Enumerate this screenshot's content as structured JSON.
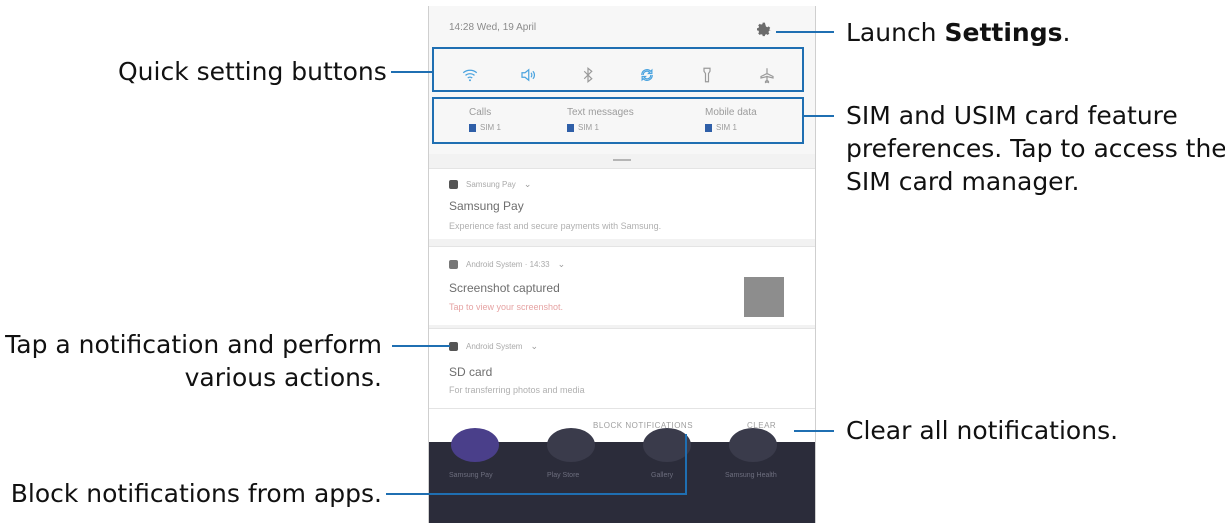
{
  "callouts": {
    "quick_settings": "Quick setting buttons",
    "tap_notification_line1": "Tap a notification and perform",
    "tap_notification_line2": "various actions.",
    "block": "Block notifications from apps.",
    "launch_prefix": "Launch ",
    "launch_bold": "Settings",
    "launch_suffix": ".",
    "sim_line1": "SIM and USIM card feature",
    "sim_line2": "preferences. Tap to access the",
    "sim_line3": "SIM card manager.",
    "clear": "Clear all notifications."
  },
  "phone": {
    "status_time": "14:28  Wed, 19 April",
    "quick_settings": [
      "wifi-icon",
      "sound-icon",
      "bluetooth-icon",
      "rotation-icon",
      "flashlight-icon",
      "airplane-icon"
    ],
    "sim": [
      {
        "title": "Calls",
        "sub": "SIM 1"
      },
      {
        "title": "Text messages",
        "sub": "SIM 1"
      },
      {
        "title": "Mobile data",
        "sub": "SIM 1"
      }
    ],
    "notifications": [
      {
        "app": "Samsung Pay",
        "title": "Samsung Pay",
        "text": "Experience fast and secure payments with Samsung."
      },
      {
        "app": "Android System · 14:33",
        "title": "Screenshot captured",
        "text": "Tap to view your screenshot."
      },
      {
        "app": "Android System",
        "title": "SD card",
        "text": "For transferring photos and media"
      }
    ],
    "block_button": "BLOCK NOTIFICATIONS",
    "clear_button": "CLEAR",
    "wallpaper_labels": [
      "Samsung Pay",
      "Play Store",
      "Gallery",
      "Samsung Health"
    ]
  },
  "colors": {
    "accent": "#1f6fb2",
    "sim_badge": "#2f5fa8",
    "wallpaper": "#2b2c3a"
  }
}
